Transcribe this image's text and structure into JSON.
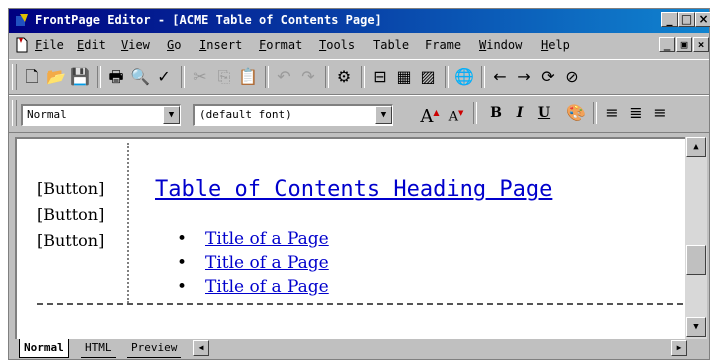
{
  "window": {
    "title": "FrontPage Editor - [ACME Table of Contents Page]"
  },
  "title_buttons": {
    "minimize": "_",
    "maximize": "□",
    "close": "×"
  },
  "menu": {
    "items": [
      {
        "first": "F",
        "rest": "ile"
      },
      {
        "first": "E",
        "rest": "dit"
      },
      {
        "first": "V",
        "rest": "iew"
      },
      {
        "first": "G",
        "rest": "o"
      },
      {
        "first": "I",
        "rest": "nsert"
      },
      {
        "first": "F",
        "rest": "ormat"
      },
      {
        "first": "T",
        "rest": "ools"
      },
      {
        "first": "",
        "rest": "Table"
      },
      {
        "first": "",
        "rest": "Frame"
      },
      {
        "first": "W",
        "rest": "indow"
      },
      {
        "first": "H",
        "rest": "elp"
      }
    ],
    "mdi_buttons": {
      "minimize": "_",
      "restore": "▣",
      "close": "×"
    }
  },
  "format_toolbar": {
    "style_value": "Normal",
    "font_value": "(default font)",
    "grow_label": "A",
    "shrink_label": "A",
    "bold_label": "B",
    "italic_label": "I",
    "underline_label": "U"
  },
  "editor": {
    "buttons": [
      "[Button]",
      "[Button]",
      "[Button]"
    ],
    "heading": "Table of Contents Heading Page",
    "list": [
      {
        "bullet": "•",
        "text": "Title of a Page"
      },
      {
        "bullet": "•",
        "text": "Title of a Page"
      },
      {
        "bullet": "•",
        "text": "Title of a Page"
      }
    ]
  },
  "tabs": [
    {
      "label": "Normal",
      "active": true
    },
    {
      "label": "HTML",
      "active": false
    },
    {
      "label": "Preview",
      "active": false
    }
  ],
  "colors": {
    "titlebar": "#000080",
    "link": "#0000cc",
    "face": "#c0c0c0"
  }
}
